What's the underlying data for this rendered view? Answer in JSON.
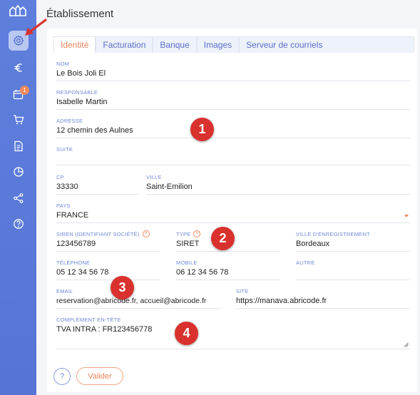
{
  "page": {
    "title": "Établissement"
  },
  "sidebar": {
    "items": [
      {
        "icon": "gear-icon"
      },
      {
        "icon": "euro-icon"
      },
      {
        "icon": "calendar-icon",
        "badge": "1"
      },
      {
        "icon": "cart-icon"
      },
      {
        "icon": "document-icon"
      },
      {
        "icon": "pie-chart-icon"
      },
      {
        "icon": "share-icon"
      },
      {
        "icon": "help-icon"
      }
    ]
  },
  "tabs": [
    {
      "label": "Identité",
      "active": true
    },
    {
      "label": "Facturation"
    },
    {
      "label": "Banque"
    },
    {
      "label": "Images"
    },
    {
      "label": "Serveur de courriels"
    }
  ],
  "form": {
    "nom": {
      "label": "NOM",
      "value": "Le Bois Joli El"
    },
    "responsable": {
      "label": "RESPONSABLE",
      "value": "Isabelle Martin"
    },
    "adresse": {
      "label": "ADRESSE",
      "value": "12 chemin des Aulnes"
    },
    "suite": {
      "label": "SUITE",
      "value": ""
    },
    "cp": {
      "label": "CP",
      "value": "33330"
    },
    "ville": {
      "label": "VILLE",
      "value": "Saint-Emilion"
    },
    "pays": {
      "label": "PAYS",
      "value": "FRANCE"
    },
    "siren": {
      "label": "SIREN (IDENTIFIANT SOCIÉTÉ)",
      "value": "123456789"
    },
    "type": {
      "label": "TYPE",
      "value": "SIRET"
    },
    "ville_enregistrement": {
      "label": "VILLE D'ENREGISTREMENT",
      "value": "Bordeaux"
    },
    "telephone": {
      "label": "TÉLÉPHONE",
      "value": "05 12 34 56 78"
    },
    "mobile": {
      "label": "MOBILE",
      "value": "06 12 34 56 78"
    },
    "autre": {
      "label": "AUTRE",
      "value": ""
    },
    "email": {
      "label": "EMAIL",
      "value": "reservation@abricode.fr, accueil@abricode.fr"
    },
    "site": {
      "label": "SITE",
      "value": "https://manava.abricode.fr"
    },
    "complement": {
      "label": "COMPLÉMENT EN-TÊTE",
      "value": "TVA INTRA :  FR123456778"
    }
  },
  "help_glyph": "?",
  "markers": [
    "1",
    "2",
    "3",
    "4"
  ],
  "buttons": {
    "help": "?",
    "valider": "Valider"
  },
  "colors": {
    "sidebar": "#5a79d8",
    "accent": "#e8855e",
    "label": "#6f88d6",
    "marker": "#d9312d"
  }
}
